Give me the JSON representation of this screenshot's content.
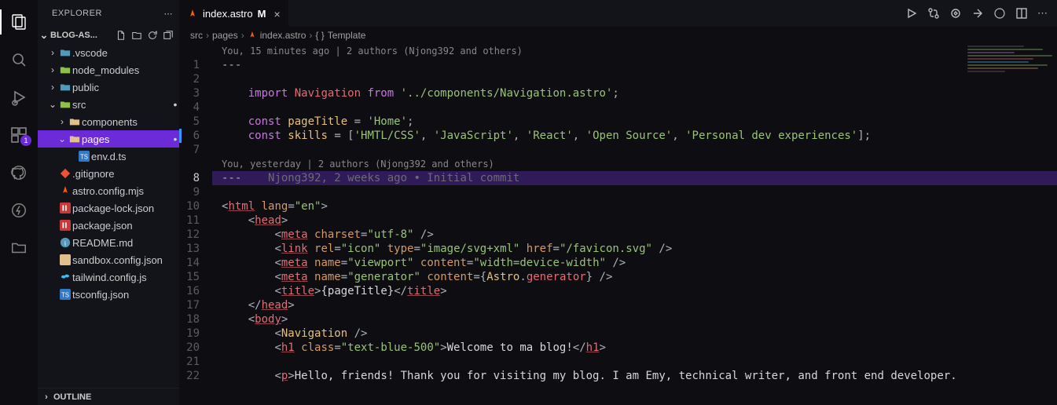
{
  "activity_bar": {
    "items": [
      {
        "name": "explorer",
        "active": true
      },
      {
        "name": "search"
      },
      {
        "name": "run-debug"
      },
      {
        "name": "extensions",
        "badge": "1"
      },
      {
        "name": "github"
      },
      {
        "name": "thunder"
      },
      {
        "name": "files"
      }
    ]
  },
  "sidebar": {
    "title": "EXPLORER",
    "project": "BLOG-AS...",
    "outline": "OUTLINE",
    "tree": [
      {
        "label": ".vscode",
        "kind": "folder",
        "icon_color": "#519aba",
        "indent": 1,
        "twisty": ">"
      },
      {
        "label": "node_modules",
        "kind": "folder",
        "icon_color": "#8dc149",
        "indent": 1,
        "twisty": ">"
      },
      {
        "label": "public",
        "kind": "folder",
        "icon_color": "#519aba",
        "indent": 1,
        "twisty": ">"
      },
      {
        "label": "src",
        "kind": "folder",
        "icon_color": "#8dc149",
        "indent": 1,
        "twisty": "v",
        "dot": true
      },
      {
        "label": "components",
        "kind": "folder",
        "icon_color": "#e2c08d",
        "indent": 2,
        "twisty": ">"
      },
      {
        "label": "pages",
        "kind": "folder",
        "icon_color": "#e2c08d",
        "indent": 2,
        "twisty": "v",
        "selected": true,
        "dot": true
      },
      {
        "label": "env.d.ts",
        "kind": "file",
        "icon": "ts",
        "indent": 3
      },
      {
        "label": ".gitignore",
        "kind": "file",
        "icon": "git",
        "indent": 1
      },
      {
        "label": "astro.config.mjs",
        "kind": "file",
        "icon": "astro",
        "indent": 1
      },
      {
        "label": "package-lock.json",
        "kind": "file",
        "icon": "npm",
        "indent": 1
      },
      {
        "label": "package.json",
        "kind": "file",
        "icon": "npm",
        "indent": 1
      },
      {
        "label": "README.md",
        "kind": "file",
        "icon": "info",
        "indent": 1
      },
      {
        "label": "sandbox.config.json",
        "kind": "file",
        "icon": "json",
        "indent": 1
      },
      {
        "label": "tailwind.config.js",
        "kind": "file",
        "icon": "tailwind",
        "indent": 1
      },
      {
        "label": "tsconfig.json",
        "kind": "file",
        "icon": "ts",
        "indent": 1
      }
    ]
  },
  "tab": {
    "label": "index.astro",
    "modified_marker": "M"
  },
  "breadcrumb": {
    "parts": [
      "src",
      "pages",
      "index.astro",
      "Template"
    ]
  },
  "codelens": {
    "top": "You, 15 minutes ago | 2 authors (Njong392 and others)",
    "section2": "You, yesterday | 2 authors (Njong392 and others)"
  },
  "blame_inline": "    Njong392, 2 weeks ago • Initial commit",
  "code": {
    "l1": "---",
    "l2": "",
    "l3_import": "import",
    "l3_nav": " Navigation ",
    "l3_from": "from",
    "l3_path": " '../components/Navigation.astro'",
    "l3_semi": ";",
    "l4": "",
    "l5_const": "const",
    "l5_var": " pageTitle ",
    "l5_eq": "= ",
    "l5_val": "'Home'",
    "l5_semi": ";",
    "l6_const": "const",
    "l6_var": " skills ",
    "l6_eq": "= [",
    "l6_s1": "'HMTL/CSS'",
    "l6_c": ", ",
    "l6_s2": "'JavaScript'",
    "l6_s3": "'React'",
    "l6_s4": "'Open Source'",
    "l6_s5": "'Personal dev experiences'",
    "l6_end": "];",
    "l7": "",
    "l8_dashes": "---",
    "l9": "",
    "l10_open": "<",
    "l10_html": "html",
    "l10_sp": " ",
    "l10_lang": "lang",
    "l10_eq": "=",
    "l10_val": "\"en\"",
    "l10_close": ">",
    "l11_indent": "    ",
    "l11_open": "<",
    "l11_head": "head",
    "l11_close": ">",
    "l12_indent": "        ",
    "l12_open": "<",
    "l12_meta": "meta",
    "l12_sp": " ",
    "l12_charset": "charset",
    "l12_eq": "=",
    "l12_val": "\"utf-8\"",
    "l12_end": " />",
    "l13_indent": "        ",
    "l13_open": "<",
    "l13_link": "link",
    "l13_rel": " rel",
    "l13_eq": "=",
    "l13_relv": "\"icon\"",
    "l13_type": " type",
    "l13_typev": "\"image/svg+xml\"",
    "l13_href": " href",
    "l13_hrefv": "\"/favicon.svg\"",
    "l13_end": " />",
    "l14_indent": "        ",
    "l14_open": "<",
    "l14_meta": "meta",
    "l14_name": " name",
    "l14_eq": "=",
    "l14_nv": "\"viewport\"",
    "l14_content": " content",
    "l14_cv": "\"width=device-width\"",
    "l14_end": " />",
    "l15_indent": "        ",
    "l15_open": "<",
    "l15_meta": "meta",
    "l15_name": " name",
    "l15_eq": "=",
    "l15_nv": "\"generator\"",
    "l15_content": " content",
    "l15_eqo": "=",
    "l15_brace": "{",
    "l15_astro": "Astro",
    "l15_dot": ".",
    "l15_gen": "generator",
    "l15_cbrace": "}",
    "l15_end": " />",
    "l16_indent": "        ",
    "l16_open": "<",
    "l16_title": "title",
    "l16_close": ">",
    "l16_b": "{pageTitle}",
    "l16_copen": "</",
    "l16_title2": "title",
    "l16_cclose": ">",
    "l17_indent": "    ",
    "l17_open": "</",
    "l17_head": "head",
    "l17_close": ">",
    "l18_indent": "    ",
    "l18_open": "<",
    "l18_body": "body",
    "l18_close": ">",
    "l19_indent": "        ",
    "l19_open": "<",
    "l19_nav": "Navigation",
    "l19_end": " />",
    "l20_indent": "        ",
    "l20_open": "<",
    "l20_h1": "h1",
    "l20_class": " class",
    "l20_eq": "=",
    "l20_cv": "\"text-blue-500\"",
    "l20_close": ">",
    "l20_text": "Welcome to ma blog!",
    "l20_copen": "</",
    "l20_h12": "h1",
    "l20_cclose": ">",
    "l21": "",
    "l22_indent": "        ",
    "l22_open": "<",
    "l22_p": "p",
    "l22_close": ">",
    "l22_text": "Hello, friends! Thank you for visiting my blog. I am Emy, technical writer, and front end developer."
  },
  "line_numbers": [
    "1",
    "2",
    "3",
    "4",
    "5",
    "6",
    "7",
    "8",
    "9",
    "10",
    "11",
    "12",
    "13",
    "14",
    "15",
    "16",
    "17",
    "18",
    "19",
    "20",
    "21",
    "22"
  ]
}
